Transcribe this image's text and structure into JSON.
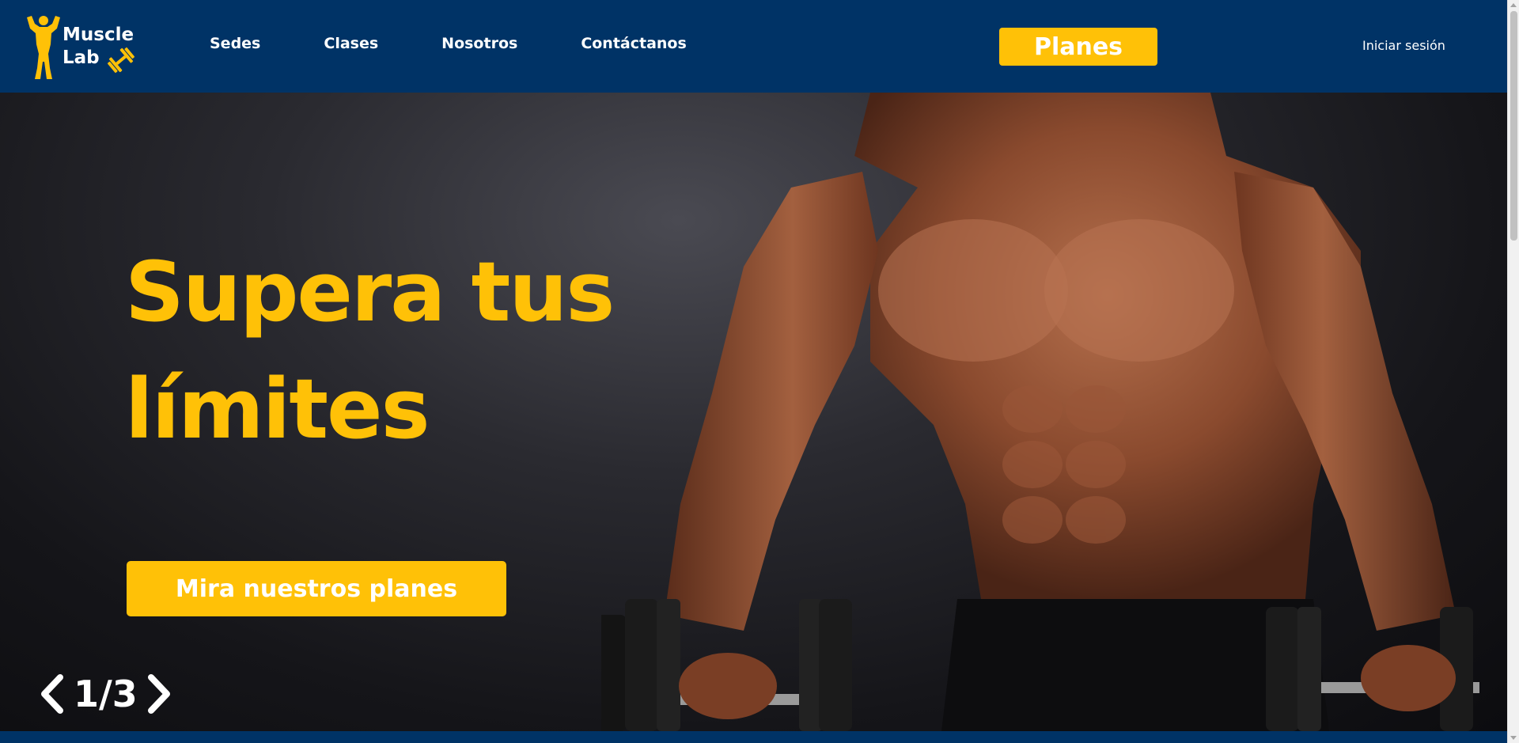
{
  "brand": {
    "name_line1": "Muscle",
    "name_line2": "Lab",
    "color_primary": "#003366",
    "color_accent": "#ffc107"
  },
  "nav": {
    "links": [
      {
        "label": "Sedes"
      },
      {
        "label": "Clases"
      },
      {
        "label": "Nosotros"
      },
      {
        "label": "Contáctanos"
      }
    ],
    "cta_label": "Planes",
    "login_label": "Iniciar sesión"
  },
  "hero": {
    "title_line1": "Supera tus",
    "title_line2": "límites",
    "cta_label": "Mira nuestros planes",
    "slide_counter": "1/3",
    "image_icon": "muscular-man-with-dumbbells"
  }
}
